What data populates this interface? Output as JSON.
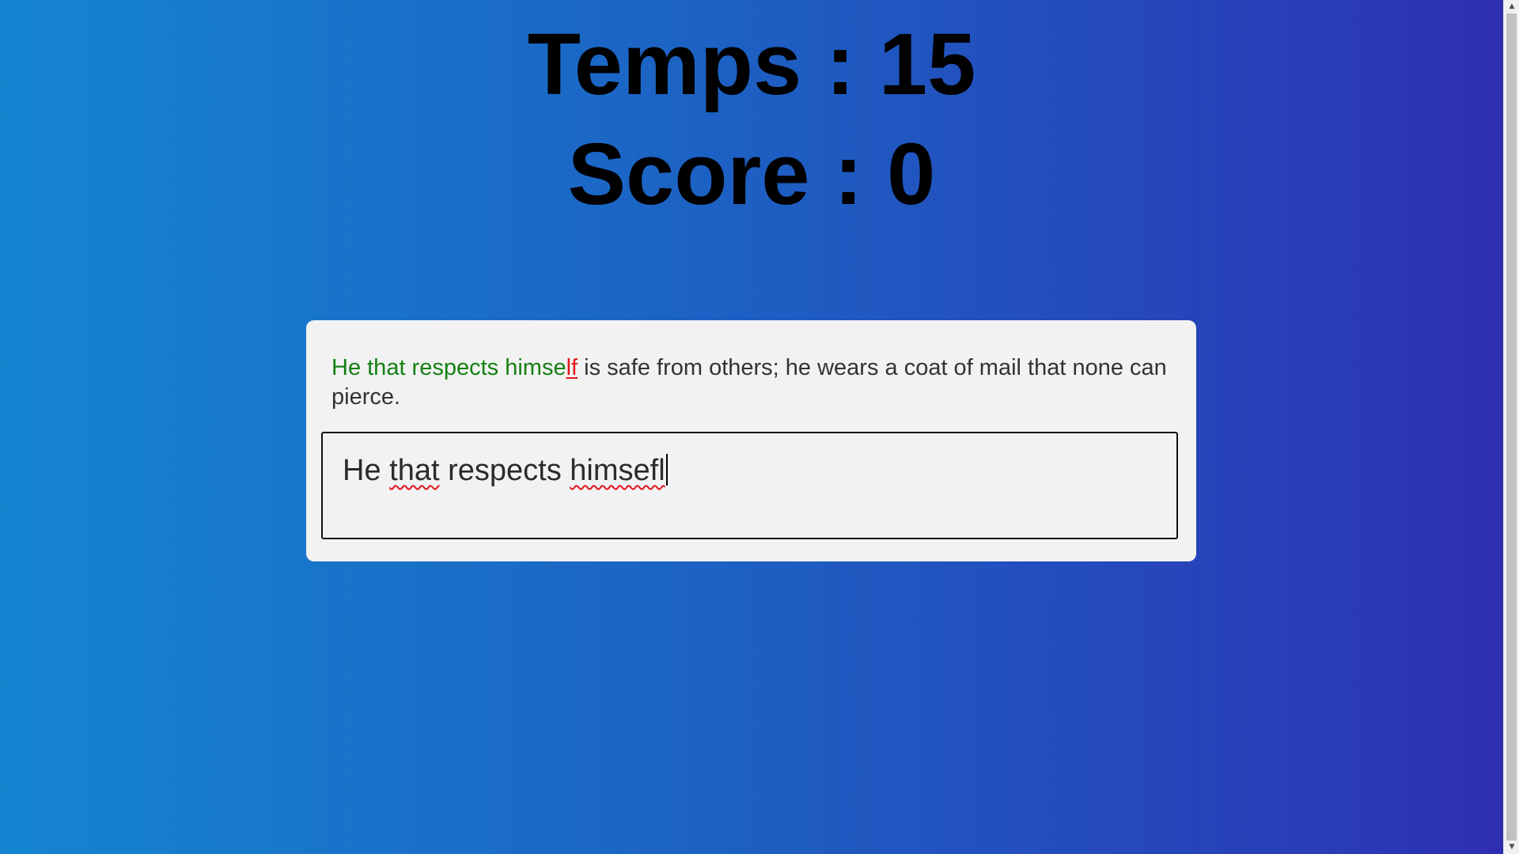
{
  "stats": {
    "time_label": "Temps : 15",
    "score_label": "Score : 0"
  },
  "quote": {
    "correct": "He that respects himse",
    "wrong": "lf",
    "remaining": " is safe from others; he wears a coat of mail that none can pierce."
  },
  "input": {
    "word_he": "He ",
    "word_that": "that",
    "word_respects": " respects ",
    "word_himsefl": "himsefl"
  },
  "scrollbar": {
    "up_icon": "▲",
    "down_icon": "▼"
  },
  "colors": {
    "correct": "#148012",
    "wrong": "#e0151b",
    "pending": "#333333",
    "card": "#f2f2f2",
    "gradient_start": "#1585d0",
    "gradient_end": "#2f2cb0"
  }
}
